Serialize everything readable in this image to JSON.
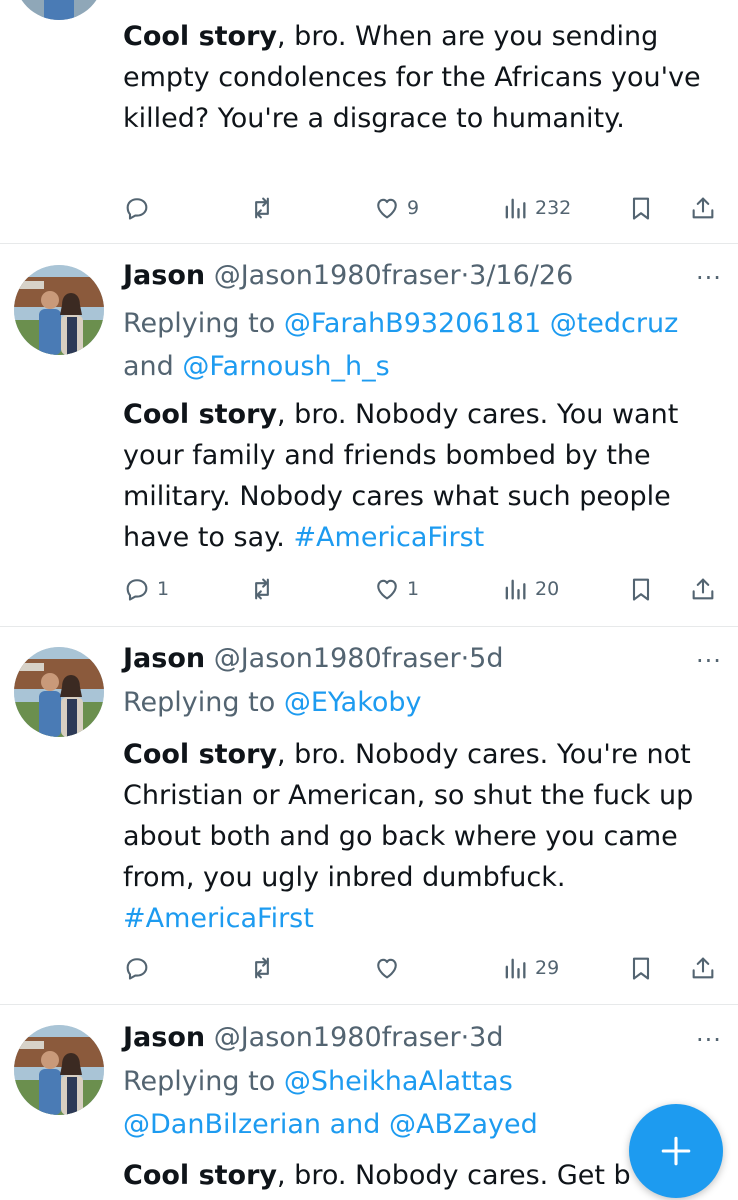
{
  "tweets": [
    {
      "body_bold": "Cool story",
      "body_rest": ", bro. When are you sending empty condolences for the Africans you've killed? You're a disgrace to humanity.",
      "hashtag": "",
      "stats": {
        "replies": "",
        "reposts": "",
        "likes": "9",
        "views": "232"
      }
    },
    {
      "name": "Jason",
      "handle": "@Jason1980fraser",
      "dot": "·",
      "date": "3/16/26",
      "replying_prefix": "Replying to ",
      "mentions": [
        "@FarahB93206181",
        "@tedcruz",
        "@Farnoush_h_s"
      ],
      "joiner": "and",
      "body_bold": "Cool story",
      "body_rest": ", bro. Nobody cares. You want your family and friends bombed by the military. Nobody cares what such people have to say. ",
      "hashtag": "#AmericaFirst",
      "stats": {
        "replies": "1",
        "reposts": "",
        "likes": "1",
        "views": "20"
      }
    },
    {
      "name": "Jason",
      "handle": "@Jason1980fraser",
      "dot": "·",
      "date": "5d",
      "replying_prefix": "Replying to ",
      "mentions": [
        "@EYakoby"
      ],
      "body_bold": "Cool story",
      "body_rest": ", bro. Nobody cares. You're not Christian or American, so shut the fuck up about both and go back where you came from, you ugly inbred dumbfuck.",
      "hashtag": "#AmericaFirst",
      "stats": {
        "replies": "",
        "reposts": "",
        "likes": "",
        "views": "29"
      }
    },
    {
      "name": "Jason",
      "handle": "@Jason1980fraser",
      "dot": "·",
      "date": "3d",
      "replying_prefix": "Replying to ",
      "mentions": [
        "@SheikhaAlattas",
        "@DanBilzerian",
        "@ABZayed"
      ],
      "joiner": "and",
      "body_bold": "Cool story",
      "body_rest": ", bro. Nobody cares. Get b"
    }
  ],
  "icons": {
    "reply": "reply-icon",
    "repost": "repost-icon",
    "like": "heart-icon",
    "views": "views-icon",
    "bookmark": "bookmark-icon",
    "share": "share-icon",
    "more": "more-icon",
    "compose": "compose-icon"
  },
  "more_glyph": "···",
  "colors": {
    "accent": "#1d9bf0",
    "secondary_text": "#536471",
    "text": "#0f1419",
    "divider": "#e7e9ea"
  }
}
